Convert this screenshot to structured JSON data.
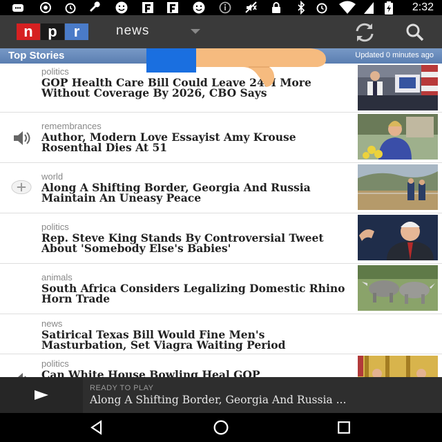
{
  "status_bar": {
    "time": "2:32",
    "left_icons": [
      "message-icon",
      "record-icon",
      "alarm-icon",
      "wrench-icon",
      "smiley-icon",
      "flipboard-icon",
      "flipboard-icon",
      "smiley-icon",
      "info-icon",
      "mute-icon"
    ],
    "right_icons": [
      "lock-icon",
      "bluetooth-icon",
      "alarm-icon",
      "wifi-icon",
      "battery-charging-icon"
    ]
  },
  "app_bar": {
    "logo_letters": [
      "n",
      "p",
      "r"
    ],
    "logo_colors": [
      "#d62021",
      "#1a1a1a",
      "#4a7bc8"
    ],
    "section": "news"
  },
  "top_stories": {
    "title": "Top Stories",
    "updated": "Updated 0 minutes ago"
  },
  "stories": [
    {
      "category": "politics",
      "headline": "GOP Health Care Bill Could Leave 24M More Without Coverage By 2026, CBO Says",
      "lead_icon": ""
    },
    {
      "category": "remembrances",
      "headline": "Author, Modern Love Essayist Amy Krouse Rosenthal Dies At 51",
      "lead_icon": "speaker-icon"
    },
    {
      "category": "world",
      "headline": "Along A Shifting Border, Georgia And Russia Maintain An Uneasy Peace",
      "lead_icon": "add-icon"
    },
    {
      "category": "politics",
      "headline": "Rep. Steve King Stands By Controversial Tweet About 'Somebody Else's Babies'",
      "lead_icon": ""
    },
    {
      "category": "animals",
      "headline": "South Africa Considers Legalizing Domestic Rhino Horn Trade",
      "lead_icon": ""
    },
    {
      "category": "news",
      "headline": "Satirical Texas Bill Would Fine Men's Masturbation, Set Viagra Waiting Period",
      "lead_icon": ""
    },
    {
      "category": "politics",
      "headline": "Can White House Bowling Heal GOP",
      "lead_icon": "speaker-icon"
    }
  ],
  "player": {
    "status": "READY TO PLAY",
    "title": "Along A Shifting Border, Georgia And Russia ..."
  },
  "nav": {
    "icons": [
      "back-icon",
      "home-icon",
      "recents-icon"
    ]
  },
  "overlay": {
    "icon": "thumbs-down-hand-icon",
    "cuff_color": "#1a6fe0",
    "hand_color": "#f6bb7f"
  }
}
